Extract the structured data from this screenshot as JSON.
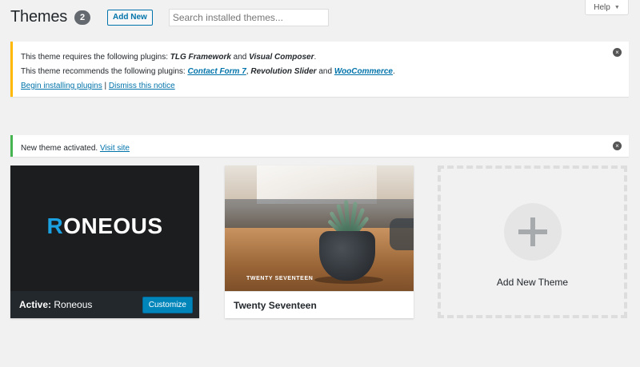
{
  "header": {
    "title": "Themes",
    "count": "2",
    "add_new_label": "Add New",
    "search_placeholder": "Search installed themes..."
  },
  "help": {
    "label": "Help",
    "caret": "▼"
  },
  "notices": {
    "plugins": {
      "line1_prefix": "This theme requires the following plugins: ",
      "req_plugin_1": "TLG Framework",
      "and_1": " and ",
      "req_plugin_2": "Visual Composer",
      "line1_suffix": ".",
      "line2_prefix": "This theme recommends the following plugins: ",
      "rec_plugin_1": "Contact Form 7",
      "comma": ", ",
      "rec_plugin_2": "Revolution Slider",
      "and_2": " and ",
      "rec_plugin_3": "WooCommerce",
      "line2_suffix": ".",
      "install_link": "Begin installing plugins",
      "separator": " | ",
      "dismiss_link": "Dismiss this notice",
      "dismiss_icon": "×"
    },
    "activated": {
      "text": "New theme activated. ",
      "link": "Visit site",
      "dismiss_icon": "×"
    }
  },
  "themes": [
    {
      "logo_first": "R",
      "logo_rest": "ONEOUS",
      "active_prefix": "Active:",
      "name": "Roneous",
      "customize_label": "Customize"
    },
    {
      "screenshot_caption": "TWENTY SEVENTEEN",
      "name": "Twenty Seventeen"
    }
  ],
  "add_theme": {
    "label": "Add New Theme"
  },
  "colors": {
    "accent": "#0073aa",
    "warning": "#ffb900",
    "success": "#46b450",
    "logo_accent": "#1ba1e2"
  }
}
